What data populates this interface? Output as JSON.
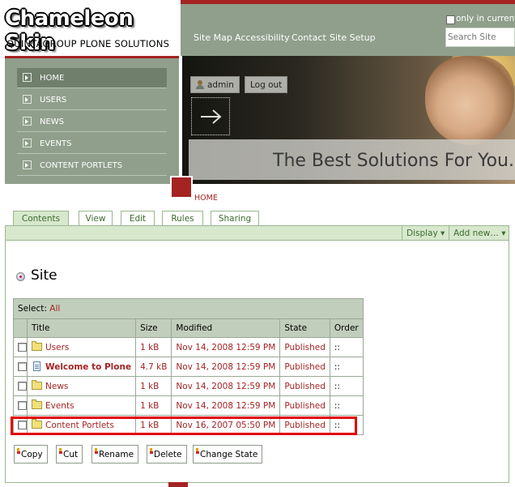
{
  "logo": {
    "title": "Chameleon Skin",
    "subtitle": "QUINTAGROUP PLONE SOLUTIONS"
  },
  "search": {
    "only_current_label": "only in current",
    "placeholder": "Search Site"
  },
  "site_actions": [
    "Site Map",
    "Accessibility",
    "Contact",
    "Site Setup"
  ],
  "nav": {
    "items": [
      "HOME",
      "USERS",
      "NEWS",
      "EVENTS",
      "CONTENT PORTLETS"
    ],
    "active_index": 0
  },
  "banner": {
    "tagline": "The Best Solutions For You."
  },
  "personal": {
    "user": "admin",
    "logout": "Log out"
  },
  "breadcrumb": "HOME",
  "tabs": [
    "Contents",
    "View",
    "Edit",
    "Rules",
    "Sharing"
  ],
  "selected_tab": "Contents",
  "action_menus": {
    "display": "Display ▾",
    "add_new": "Add new… ▾"
  },
  "page_title": "Site",
  "table": {
    "select_label": "Select:",
    "select_all": "All",
    "headers": {
      "title": "Title",
      "size": "Size",
      "modified": "Modified",
      "state": "State",
      "order": "Order"
    },
    "rows": [
      {
        "title": "Users",
        "size": "1 kB",
        "modified": "Nov 14, 2008 12:59 PM",
        "state": "Published",
        "order": "::",
        "icon": "folder-icon"
      },
      {
        "title": "Welcome to Plone",
        "size": "4.7 kB",
        "modified": "Nov 14, 2008 12:59 PM",
        "state": "Published",
        "order": "::",
        "icon": "document-icon"
      },
      {
        "title": "News",
        "size": "1 kB",
        "modified": "Nov 14, 2008 12:59 PM",
        "state": "Published",
        "order": "::",
        "icon": "folder-icon"
      },
      {
        "title": "Events",
        "size": "1 kB",
        "modified": "Nov 14, 2008 12:59 PM",
        "state": "Published",
        "order": "::",
        "icon": "folder-icon"
      },
      {
        "title": "Content Portlets",
        "size": "1 kB",
        "modified": "Nov 16, 2007 05:50 PM",
        "state": "Published",
        "order": "::",
        "icon": "folder-icon"
      }
    ]
  },
  "buttons": [
    "Copy",
    "Cut",
    "Rename",
    "Delete",
    "Change State"
  ],
  "colors": {
    "accent_red": "#a52323",
    "header_green": "#8f9f8b",
    "tab_green": "#d7e8cd",
    "highlight": "#e10000"
  }
}
